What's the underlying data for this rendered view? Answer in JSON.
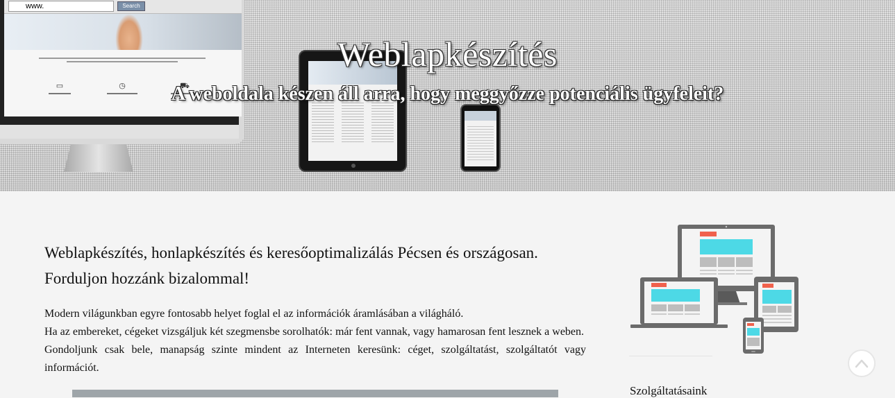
{
  "hero": {
    "title": "Weblapkészítés",
    "subtitle": "A weboldala készen áll arra, hogy meggyőzze potenciális ügyfeleit?",
    "mockup": {
      "url_text": "www.",
      "search_label": "Search"
    }
  },
  "main": {
    "heading": "Weblapkészítés, honlapkészítés és keresőoptimalizálás Pécsen és országosan. Forduljon hozzánk bizalommal!",
    "paragraph_lines": [
      "Modern világunkban egyre fontosabb helyet foglal el az információk áramlásában a világháló.",
      "Ha az embereket, cégeket vizsgáljuk két szegmensbe sorolhatók: már fent vannak, vagy hamarosan fent lesznek a weben.",
      "Gondoljunk csak bele, manapság szinte mindent az Interneten keresünk: céget, szolgáltatást, szolgáltatót vagy információt."
    ]
  },
  "sidebar": {
    "illustration_icon": "responsive-devices-icon",
    "heading": "Szolgáltatásaink"
  },
  "back_to_top": {
    "icon": "chevron-up-icon"
  },
  "colors": {
    "page_background": "#f4f4f4",
    "device_grey": "#6b6b6b",
    "accent_cyan": "#4dd9e6",
    "accent_red": "#f0614c"
  }
}
